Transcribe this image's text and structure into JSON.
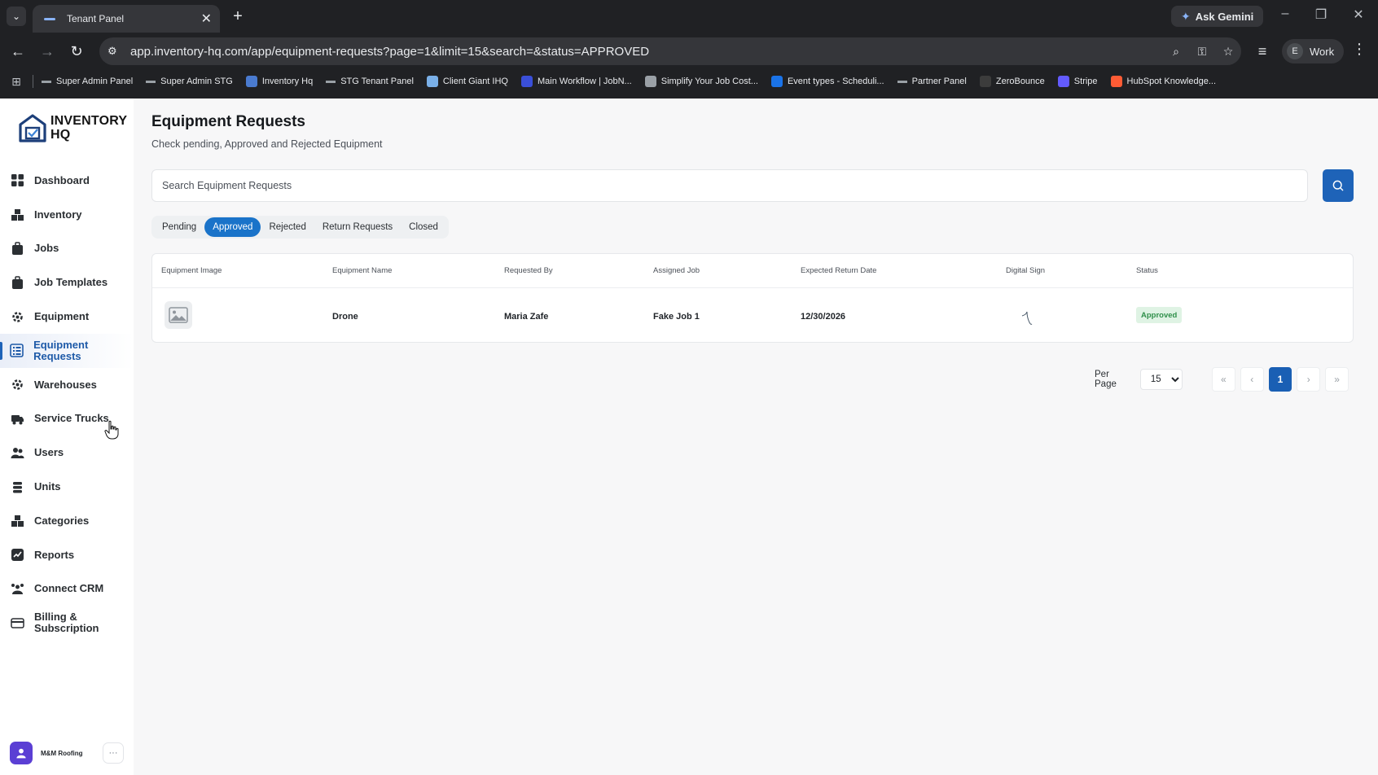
{
  "browser": {
    "tab_title": "Tenant Panel",
    "url": "app.inventory-hq.com/app/equipment-requests?page=1&limit=15&search=&status=APPROVED",
    "ask_gemini": "Ask Gemini",
    "profile_initial": "E",
    "profile_name": "Work",
    "bookmarks": [
      {
        "label": "Super Admin Panel",
        "icon": "dash",
        "color": ""
      },
      {
        "label": "Super Admin STG",
        "icon": "dash",
        "color": ""
      },
      {
        "label": "Inventory Hq",
        "icon": "box",
        "color": "#4a7bd0"
      },
      {
        "label": "STG Tenant Panel",
        "icon": "dash",
        "color": ""
      },
      {
        "label": "Client Giant IHQ",
        "icon": "box",
        "color": "#7ab0e8"
      },
      {
        "label": "Main Workflow | JobN...",
        "icon": "box",
        "color": "#3a4fd8"
      },
      {
        "label": "Simplify Your Job Cost...",
        "icon": "box",
        "color": "#9aa0a6"
      },
      {
        "label": "Event types - Scheduli...",
        "icon": "box",
        "color": "#1a73e8"
      },
      {
        "label": "Partner Panel",
        "icon": "dash",
        "color": ""
      },
      {
        "label": "ZeroBounce",
        "icon": "box",
        "color": "#3c3c3c"
      },
      {
        "label": "Stripe",
        "icon": "box",
        "color": "#635bff"
      },
      {
        "label": "HubSpot Knowledge...",
        "icon": "box",
        "color": "#ff5c35"
      }
    ]
  },
  "app": {
    "logo_line1": "INVENTORY",
    "logo_line2": "HQ",
    "nav": [
      {
        "label": "Dashboard",
        "icon": "dashboard-icon"
      },
      {
        "label": "Inventory",
        "icon": "inventory-icon"
      },
      {
        "label": "Jobs",
        "icon": "jobs-icon"
      },
      {
        "label": "Job Templates",
        "icon": "job-templates-icon"
      },
      {
        "label": "Equipment",
        "icon": "equipment-icon"
      },
      {
        "label": "Equipment Requests",
        "icon": "equipment-requests-icon"
      },
      {
        "label": "Warehouses",
        "icon": "warehouses-icon"
      },
      {
        "label": "Service Trucks",
        "icon": "truck-icon"
      },
      {
        "label": "Users",
        "icon": "users-icon"
      },
      {
        "label": "Units",
        "icon": "units-icon"
      },
      {
        "label": "Categories",
        "icon": "categories-icon"
      },
      {
        "label": "Reports",
        "icon": "reports-icon"
      },
      {
        "label": "Connect CRM",
        "icon": "crm-icon"
      },
      {
        "label": "Billing & Subscription",
        "icon": "billing-icon"
      }
    ],
    "active_nav": "Equipment Requests",
    "org_name": "M&M Roofing",
    "accent": "#1e63b8"
  },
  "page": {
    "title": "Equipment Requests",
    "subtitle": "Check pending, Approved and Rejected Equipment",
    "search_placeholder": "Search Equipment Requests",
    "tabs": [
      "Pending",
      "Approved",
      "Rejected",
      "Return Requests",
      "Closed"
    ],
    "active_tab": "Approved",
    "columns": [
      "Equipment Image",
      "Equipment Name",
      "Requested By",
      "Assigned Job",
      "Expected Return Date",
      "Digital Sign",
      "Status"
    ],
    "rows": [
      {
        "equipment_name": "Drone",
        "requested_by": "Maria Zafe",
        "assigned_job": "Fake Job 1",
        "expected_return_date": "12/30/2026",
        "status": "Approved"
      }
    ],
    "pagination": {
      "per_page_label": "Per Page",
      "per_page": "15",
      "first": "«",
      "prev": "‹",
      "current": "1",
      "next": "›",
      "last": "»"
    }
  }
}
